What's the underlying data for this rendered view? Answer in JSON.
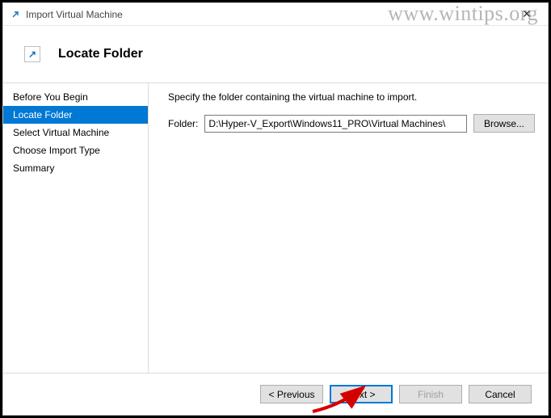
{
  "window": {
    "title": "Import Virtual Machine",
    "close_glyph": "✕"
  },
  "watermark": "www.wintips.org",
  "header": {
    "title": "Locate Folder",
    "icon_glyph": "↗"
  },
  "sidebar": {
    "steps": [
      {
        "label": "Before You Begin",
        "active": false
      },
      {
        "label": "Locate Folder",
        "active": true
      },
      {
        "label": "Select Virtual Machine",
        "active": false
      },
      {
        "label": "Choose Import Type",
        "active": false
      },
      {
        "label": "Summary",
        "active": false
      }
    ]
  },
  "content": {
    "instruction": "Specify the folder containing the virtual machine to import.",
    "folder_label": "Folder:",
    "folder_value": "D:\\Hyper-V_Export\\Windows11_PRO\\Virtual Machines\\",
    "browse_label": "Browse..."
  },
  "footer": {
    "previous_label": "< Previous",
    "next_label": "Next >",
    "finish_label": "Finish",
    "cancel_label": "Cancel"
  }
}
